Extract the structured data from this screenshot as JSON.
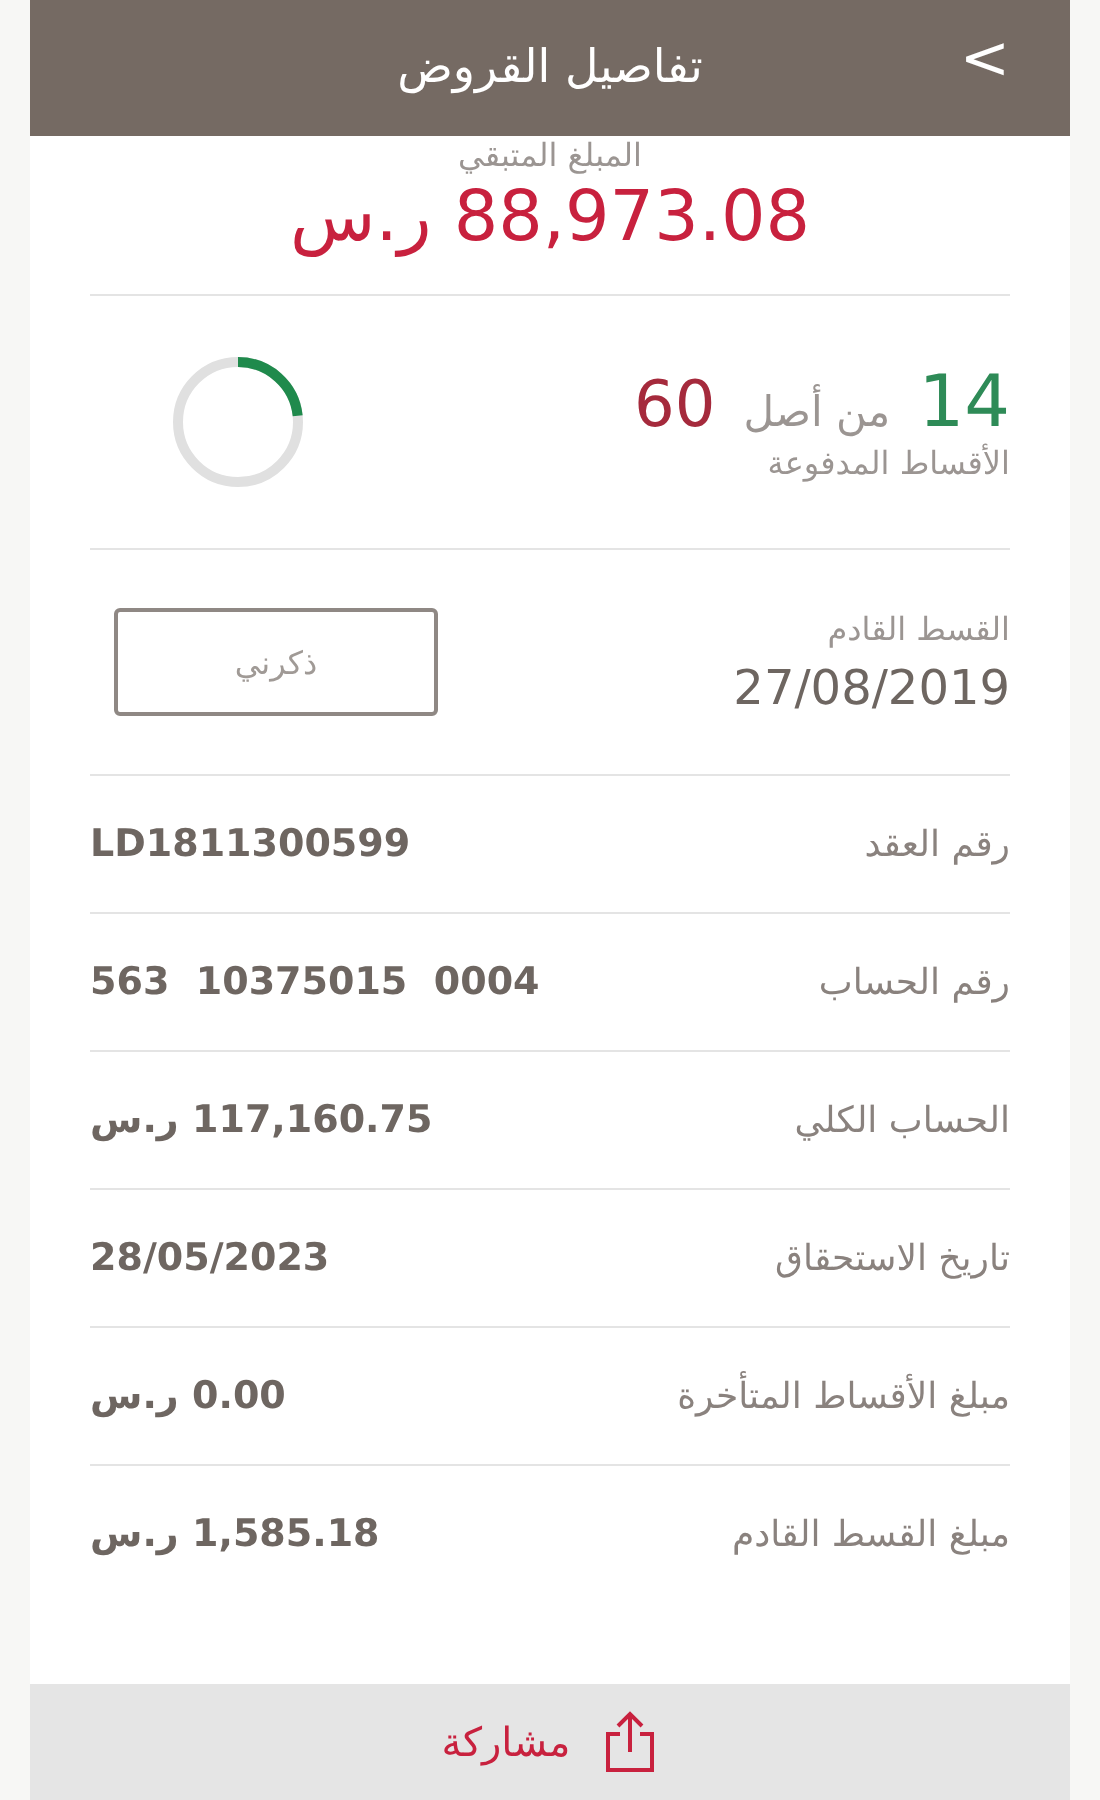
{
  "header": {
    "title": "تفاصيل القروض",
    "back": ">"
  },
  "remaining": {
    "label": "المبلغ المتبقي",
    "amount": "88,973.08 ر.س"
  },
  "installments": {
    "paid": "14",
    "of": "من أصل",
    "total": "60",
    "caption": "الأقساط المدفوعة",
    "level": 0.233
  },
  "next_installment": {
    "label": "القسط القادم",
    "date": "27/08/2019",
    "remind_button": "ذكرني"
  },
  "details": [
    {
      "label": "رقم العقد",
      "value": "LD1811300599"
    },
    {
      "label": "رقم الحساب",
      "value": "563  10375015  0004"
    },
    {
      "label": "الحساب الكلي",
      "value": "117,160.75 ر.س"
    },
    {
      "label": "تاريخ الاستحقاق",
      "value": "28/05/2023"
    },
    {
      "label": "مبلغ الأقساط المتأخرة",
      "value": "0.00 ر.س"
    },
    {
      "label": "مبلغ القسط القادم",
      "value": "1,585.18 ر.س"
    }
  ],
  "footer": {
    "share": "مشاركة"
  }
}
